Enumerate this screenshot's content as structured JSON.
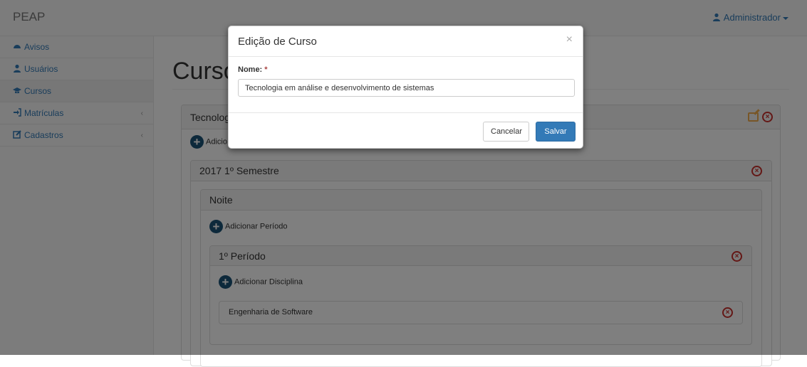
{
  "navbar": {
    "brand": "PEAP",
    "user": "Administrador"
  },
  "sidebar": {
    "items": [
      {
        "label": "Avisos"
      },
      {
        "label": "Usuários"
      },
      {
        "label": "Cursos"
      },
      {
        "label": "Matrículas"
      },
      {
        "label": "Cadastros"
      }
    ]
  },
  "main": {
    "page_title": "Curso",
    "course_panel_title": "Tecnolog",
    "add_semester_partial": "Adicio",
    "semester_title": "2017 1º Semestre",
    "shift_title": "Noite",
    "add_period": "Adicionar Período",
    "period_title": "1º Período",
    "add_discipline": "Adicionar Disciplina",
    "discipline": "Engenharia de Software"
  },
  "modal": {
    "title": "Edição de Curso",
    "close": "×",
    "field_label": "Nome:",
    "required_mark": "*",
    "field_value": "Tecnologia em análise e desenvolvimento de sistemas",
    "cancel_label": "Cancelar",
    "save_label": "Salvar"
  }
}
